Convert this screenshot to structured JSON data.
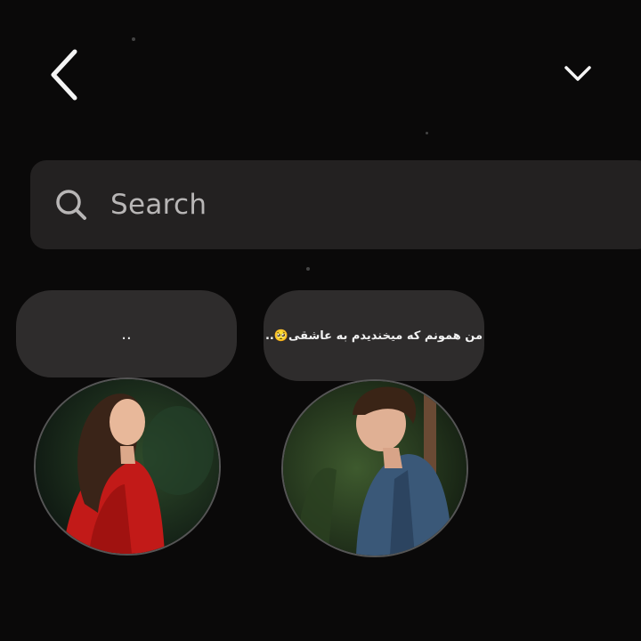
{
  "nav": {
    "back_icon": "chevron-left-icon",
    "dropdown_icon": "chevron-down-icon"
  },
  "search": {
    "placeholder": "Search",
    "icon": "search-icon"
  },
  "contacts": [
    {
      "note": "..",
      "avatar": "woman-red-jacket-avatar"
    },
    {
      "note": "من همونم که میخندیدم به عاشقی🥺..",
      "avatar": "man-denim-shirt-avatar"
    }
  ],
  "colors": {
    "background": "#0a0909",
    "search_bar": "#232121",
    "bubble": "#2e2c2c",
    "text": "#f2f2f2"
  }
}
